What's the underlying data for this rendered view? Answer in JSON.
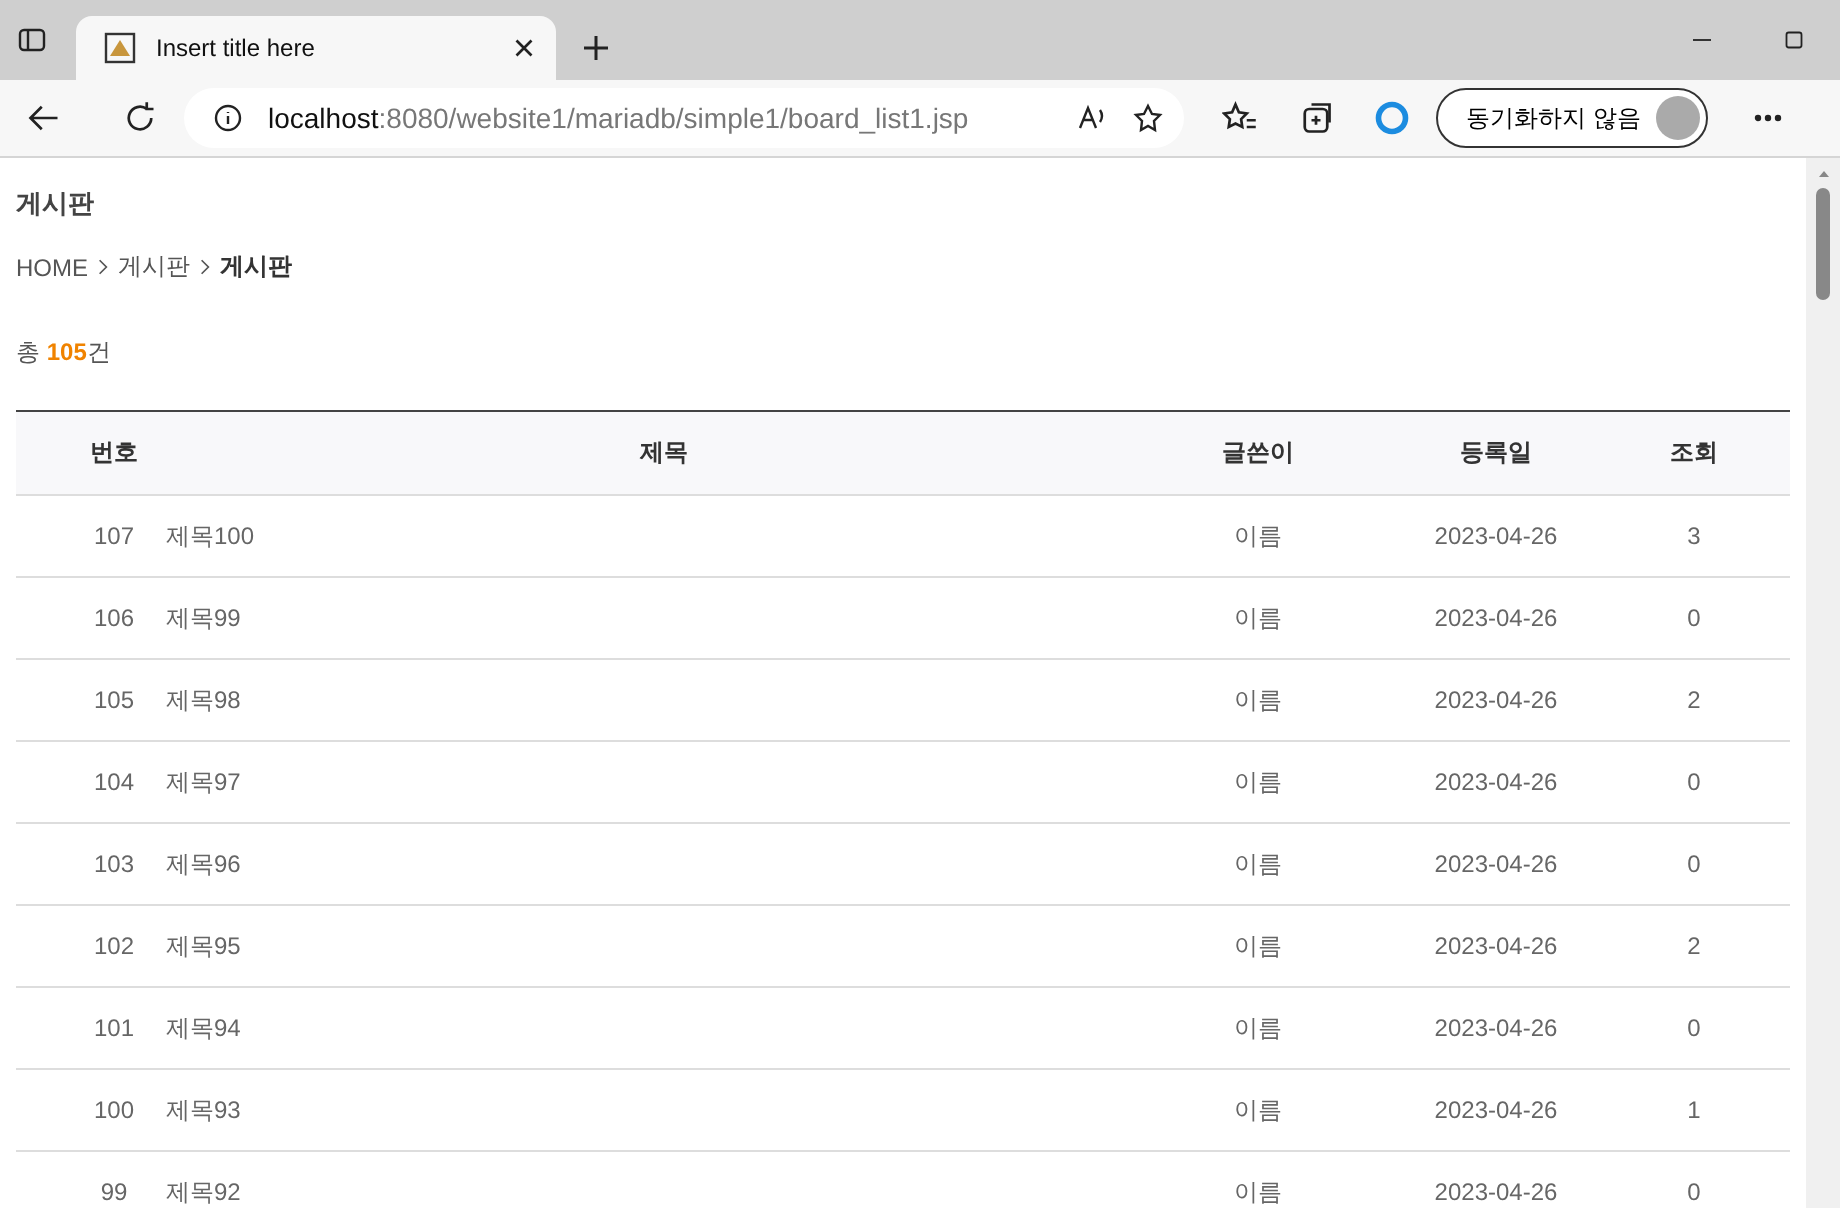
{
  "browser": {
    "tab_title": "Insert title here",
    "url_host": "localhost",
    "url_path": ":8080/website1/mariadb/simple1/board_list1.jsp",
    "sync_button": "동기화하지 않음"
  },
  "page": {
    "heading": "게시판",
    "breadcrumb": [
      {
        "label": "HOME",
        "current": false
      },
      {
        "label": "게시판",
        "current": false
      },
      {
        "label": "게시판",
        "current": true
      }
    ],
    "total": {
      "prefix": "총",
      "count": "105",
      "suffix": "건"
    },
    "table": {
      "columns": [
        "번호",
        "제목",
        "글쓴이",
        "등록일",
        "조회"
      ],
      "rows": [
        [
          "107",
          "제목100",
          "이름",
          "2023-04-26",
          "3"
        ],
        [
          "106",
          "제목99",
          "이름",
          "2023-04-26",
          "0"
        ],
        [
          "105",
          "제목98",
          "이름",
          "2023-04-26",
          "2"
        ],
        [
          "104",
          "제목97",
          "이름",
          "2023-04-26",
          "0"
        ],
        [
          "103",
          "제목96",
          "이름",
          "2023-04-26",
          "0"
        ],
        [
          "102",
          "제목95",
          "이름",
          "2023-04-26",
          "2"
        ],
        [
          "101",
          "제목94",
          "이름",
          "2023-04-26",
          "0"
        ],
        [
          "100",
          "제목93",
          "이름",
          "2023-04-26",
          "1"
        ],
        [
          "99",
          "제목92",
          "이름",
          "2023-04-26",
          "0"
        ]
      ]
    }
  }
}
